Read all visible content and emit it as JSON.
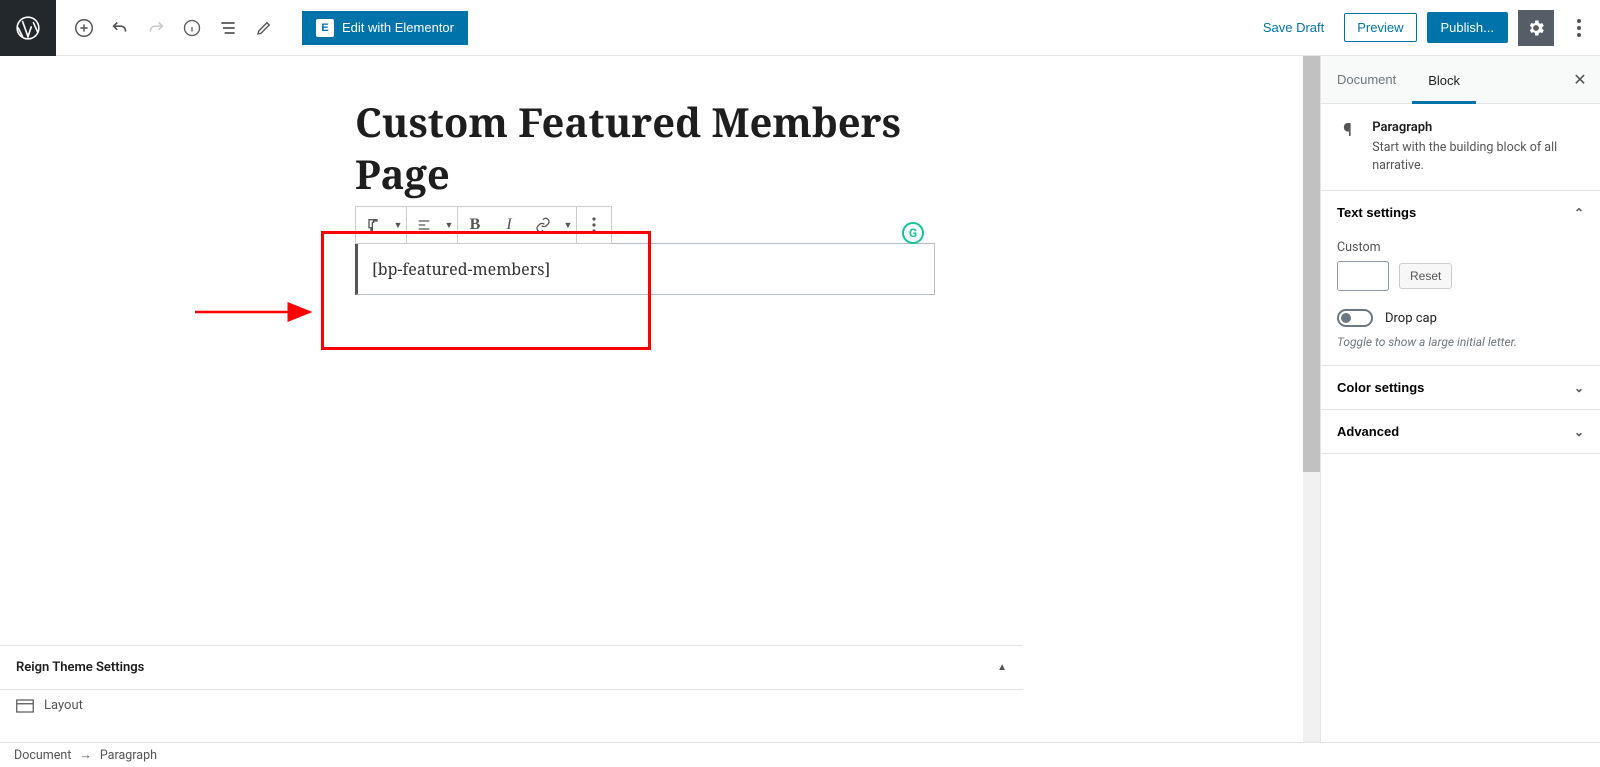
{
  "topbar": {
    "elementor_label": "Edit with Elementor",
    "save_draft": "Save Draft",
    "preview": "Preview",
    "publish": "Publish..."
  },
  "page": {
    "title": "Custom Featured Members Page",
    "paragraph_content": "[bp-featured-members]"
  },
  "sidebar": {
    "tab_document": "Document",
    "tab_block": "Block",
    "block_name": "Paragraph",
    "block_desc": "Start with the building block of all narrative.",
    "text_settings": "Text settings",
    "custom_label": "Custom",
    "reset_label": "Reset",
    "dropcap_label": "Drop cap",
    "dropcap_hint": "Toggle to show a large initial letter.",
    "color_settings": "Color settings",
    "advanced": "Advanced"
  },
  "theme_panel": {
    "title": "Reign Theme Settings",
    "layout": "Layout"
  },
  "footer": {
    "document": "Document",
    "paragraph": "Paragraph"
  }
}
